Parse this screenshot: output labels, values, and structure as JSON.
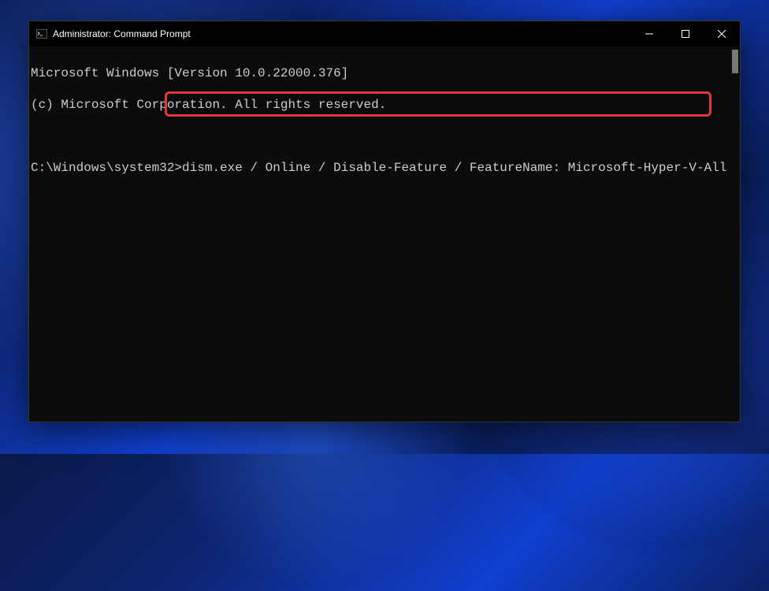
{
  "window": {
    "title": "Administrator: Command Prompt"
  },
  "terminal": {
    "line1": "Microsoft Windows [Version 10.0.22000.376]",
    "line2": "(c) Microsoft Corporation. All rights reserved.",
    "prompt": "C:\\Windows\\system32>",
    "command": "dism.exe / Online / Disable-Feature / FeatureName: Microsoft-Hyper-V-All"
  },
  "highlight": {
    "color": "#e23a3a"
  }
}
